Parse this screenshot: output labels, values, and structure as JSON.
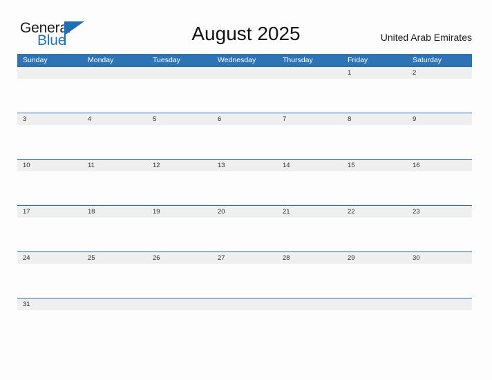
{
  "brand": {
    "word_one": "General",
    "word_two": "Blue",
    "triangle_icon": "triangle-icon",
    "color_primary": "#1f6fb8",
    "color_text": "#1a1a1a"
  },
  "header": {
    "title": "August 2025",
    "region": "United Arab Emirates"
  },
  "theme": {
    "header_blue": "#2e74b5",
    "divider_blue": "#2a6aa6",
    "date_band_gray": "#efefef",
    "page_background": "#fdfdfd"
  },
  "calendar": {
    "month": "August",
    "year": "2025",
    "weekday_headers": [
      "Sunday",
      "Monday",
      "Tuesday",
      "Wednesday",
      "Thursday",
      "Friday",
      "Saturday"
    ],
    "weeks": [
      {
        "days": [
          "",
          "",
          "",
          "",
          "",
          "1",
          "2"
        ]
      },
      {
        "days": [
          "3",
          "4",
          "5",
          "6",
          "7",
          "8",
          "9"
        ]
      },
      {
        "days": [
          "10",
          "11",
          "12",
          "13",
          "14",
          "15",
          "16"
        ]
      },
      {
        "days": [
          "17",
          "18",
          "19",
          "20",
          "21",
          "22",
          "23"
        ]
      },
      {
        "days": [
          "24",
          "25",
          "26",
          "27",
          "28",
          "29",
          "30"
        ]
      },
      {
        "days": [
          "31",
          "",
          "",
          "",
          "",
          "",
          ""
        ]
      }
    ]
  }
}
